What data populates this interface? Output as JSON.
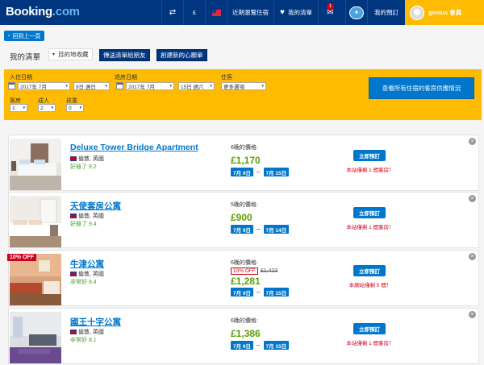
{
  "header": {
    "logo_main": "Booking",
    "logo_suffix": ".com",
    "currency": "£",
    "recently_viewed": "近期瀏覽住宿",
    "wishlist": "我的清單",
    "mail_badge": "1",
    "my_bookings": "我的預訂",
    "user_label": "genius 會員"
  },
  "nav": {
    "back_label": "回到上一頁",
    "list_title": "我的清單",
    "list_select": "目的地收藏",
    "share_button": "傳送清單給朋友",
    "create_button": "創建新的心願單"
  },
  "search": {
    "checkin_label": "入住日期",
    "checkout_label": "退房日期",
    "checkin_month": "2017年 7月",
    "checkin_day": "9日 週日",
    "checkout_month": "2017年 7月",
    "checkout_day": "15日 週六",
    "guests_label": "住客",
    "guests_value": "更多選項",
    "rooms_label": "客房",
    "rooms_value": "1",
    "adults_label": "成人",
    "adults_value": "2",
    "children_label": "孩童",
    "children_value": "0",
    "availability_button": "查看所有住宿的客房供應情況"
  },
  "properties": [
    {
      "name": "Deluxe Tower Bridge Apartment",
      "location": "倫敦, 英國",
      "rating": "好極了 9.2",
      "nights_label": "6晚的價格:",
      "price": "£1,170",
      "checkin": "7月 9日",
      "checkout": "7月 15日",
      "book": "立即預訂",
      "note": "本站僅剩 1 間客房！"
    },
    {
      "name": "天使套房公寓",
      "location": "倫敦, 英國",
      "rating": "好極了 9.4",
      "nights_label": "5晚的價格:",
      "price": "£900",
      "checkin": "7月 9日",
      "checkout": "7月 14日",
      "book": "立即預訂",
      "note": "本站僅剩 1 間客房！"
    },
    {
      "name": "牛津公寓",
      "location": "倫敦, 英國",
      "rating": "非常好 8.4",
      "nights_label": "6晚的價格:",
      "discount_tag": "10% OFF",
      "original_price": "£1,423",
      "price": "£1,281",
      "checkin": "7月 9日",
      "checkout": "7月 15日",
      "book": "立即預訂",
      "note": "本網站僅剩 5 間！",
      "badge": "10% OFF"
    },
    {
      "name": "國王十字公寓",
      "location": "倫敦, 英國",
      "rating": "非常好 8.1",
      "nights_label": "6晚的價格:",
      "price": "£1,386",
      "checkin": "7月 9日",
      "checkout": "7月 15日",
      "book": "立即預訂",
      "note": "本站僅剩 1 間客房！"
    }
  ],
  "colors": {
    "header_bg": "#003580",
    "genius_bg": "#febb02",
    "accent_blue": "#0077cc",
    "price_green": "#5b9f00",
    "alert_red": "#d0021b"
  }
}
